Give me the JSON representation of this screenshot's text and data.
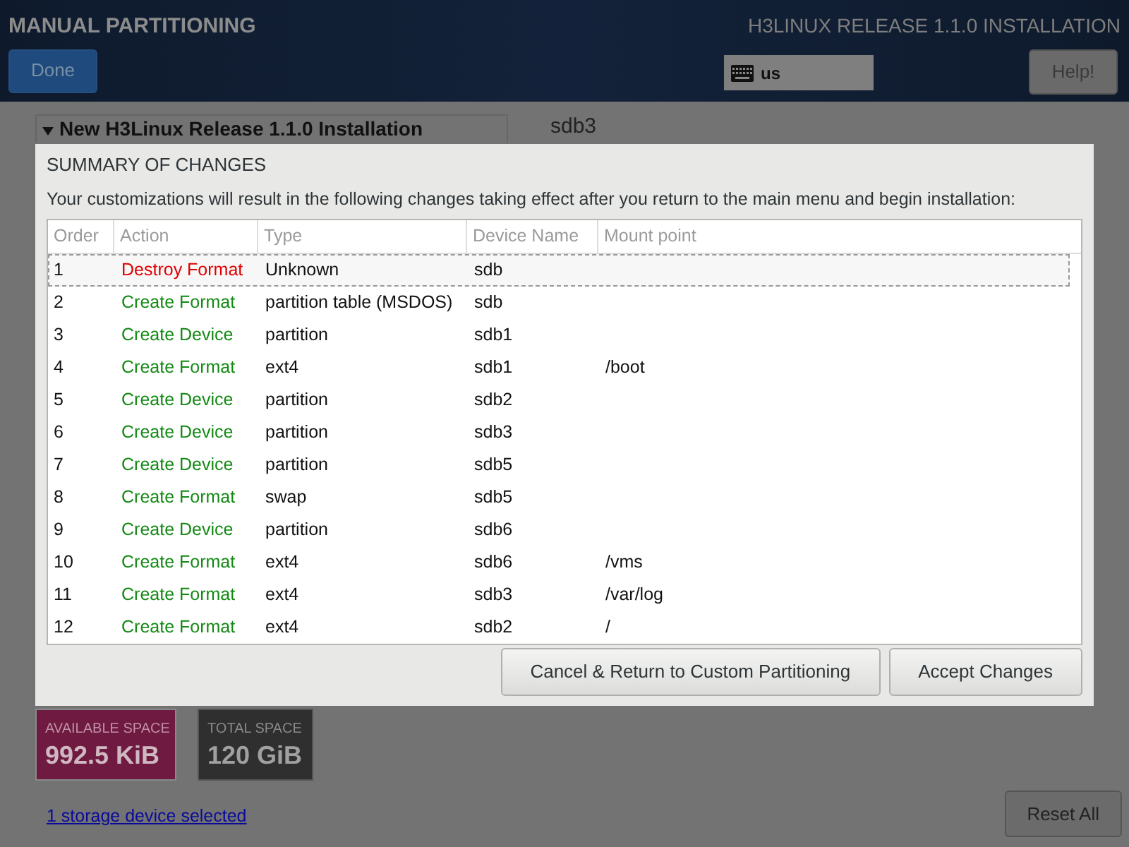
{
  "header": {
    "title": "MANUAL PARTITIONING",
    "done_button": "Done",
    "product": "H3LINUX RELEASE 1.1.0 INSTALLATION",
    "keyboard_layout": "us",
    "help_button": "Help!"
  },
  "background": {
    "section_title": "New H3Linux Release 1.1.0 Installation",
    "device_title": "sdb3"
  },
  "dialog": {
    "title": "SUMMARY OF CHANGES",
    "message": "Your customizations will result in the following changes taking effect after you return to the main menu and begin installation:",
    "columns": [
      "Order",
      "Action",
      "Type",
      "Device Name",
      "Mount point"
    ],
    "rows": [
      {
        "order": "1",
        "action": "Destroy Format",
        "kind": "destroy",
        "type": "Unknown",
        "device": "sdb",
        "mount": "",
        "selected": true
      },
      {
        "order": "2",
        "action": "Create Format",
        "kind": "create",
        "type": "partition table (MSDOS)",
        "device": "sdb",
        "mount": "",
        "selected": false
      },
      {
        "order": "3",
        "action": "Create Device",
        "kind": "create",
        "type": "partition",
        "device": "sdb1",
        "mount": "",
        "selected": false
      },
      {
        "order": "4",
        "action": "Create Format",
        "kind": "create",
        "type": "ext4",
        "device": "sdb1",
        "mount": "/boot",
        "selected": false
      },
      {
        "order": "5",
        "action": "Create Device",
        "kind": "create",
        "type": "partition",
        "device": "sdb2",
        "mount": "",
        "selected": false
      },
      {
        "order": "6",
        "action": "Create Device",
        "kind": "create",
        "type": "partition",
        "device": "sdb3",
        "mount": "",
        "selected": false
      },
      {
        "order": "7",
        "action": "Create Device",
        "kind": "create",
        "type": "partition",
        "device": "sdb5",
        "mount": "",
        "selected": false
      },
      {
        "order": "8",
        "action": "Create Format",
        "kind": "create",
        "type": "swap",
        "device": "sdb5",
        "mount": "",
        "selected": false
      },
      {
        "order": "9",
        "action": "Create Device",
        "kind": "create",
        "type": "partition",
        "device": "sdb6",
        "mount": "",
        "selected": false
      },
      {
        "order": "10",
        "action": "Create Format",
        "kind": "create",
        "type": "ext4",
        "device": "sdb6",
        "mount": "/vms",
        "selected": false
      },
      {
        "order": "11",
        "action": "Create Format",
        "kind": "create",
        "type": "ext4",
        "device": "sdb3",
        "mount": "/var/log",
        "selected": false
      },
      {
        "order": "12",
        "action": "Create Format",
        "kind": "create",
        "type": "ext4",
        "device": "sdb2",
        "mount": "/",
        "selected": false
      }
    ],
    "buttons": [
      "Cancel & Return to Custom Partitioning",
      "Accept Changes"
    ]
  },
  "space": {
    "available_label": "AVAILABLE SPACE",
    "available_value": "992.5 KiB",
    "total_label": "TOTAL SPACE",
    "total_value": "120 GiB"
  },
  "storage_link": "1 storage device selected",
  "reset_button": "Reset All"
}
